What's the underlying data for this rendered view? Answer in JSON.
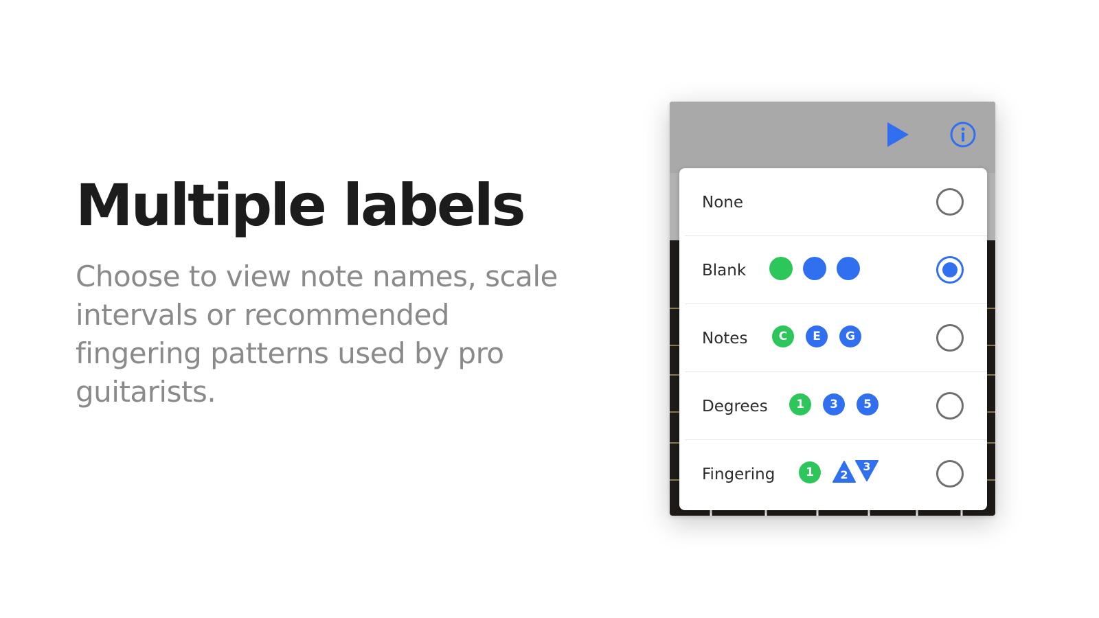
{
  "headline": "Multiple labels",
  "body": "Choose to view note names, scale intervals or recommended fingering patterns used by pro guitarists.",
  "colors": {
    "green": "#2cc65a",
    "blue": "#2f6ff0",
    "toolbar": "#a9a9a9",
    "fretboard": "#1e1a17"
  },
  "toolbar": {
    "play_icon": "play-icon",
    "info_icon": "info-icon"
  },
  "menu": {
    "items": [
      {
        "label": "None",
        "selected": false,
        "markers": []
      },
      {
        "label": "Blank",
        "selected": true,
        "markers": [
          "",
          "",
          ""
        ]
      },
      {
        "label": "Notes",
        "selected": false,
        "markers": [
          "C",
          "E",
          "G"
        ]
      },
      {
        "label": "Degrees",
        "selected": false,
        "markers": [
          "1",
          "3",
          "5"
        ]
      },
      {
        "label": "Fingering",
        "selected": false,
        "markers": [
          "1",
          "2",
          "3"
        ]
      }
    ]
  }
}
